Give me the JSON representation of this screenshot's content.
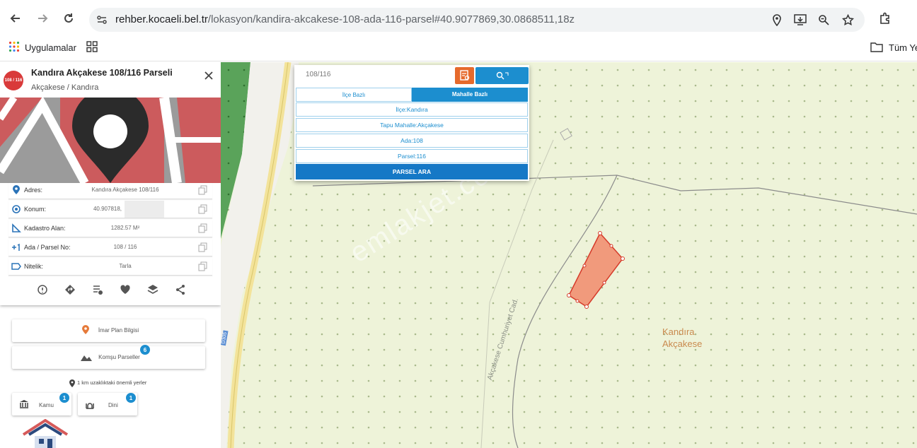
{
  "browser": {
    "url_host": "rehber.kocaeli.bel.tr",
    "url_path": "/lokasyon/kandira-akcakese-108-ada-116-parsel#40.9077869,30.0868511,18z",
    "bookmarks": {
      "apps_label": "Uygulamalar",
      "all_label": "Tüm Ye"
    }
  },
  "panel": {
    "logo_text": "108 / 116",
    "title": "Kandıra Akçakese 108/116 Parseli",
    "subtitle": "Akçakese / Kandıra",
    "rows": [
      {
        "label": "Adres:",
        "value": "Kandıra Akçakese 108/116"
      },
      {
        "label": "Konum:",
        "value": "40.907818,"
      },
      {
        "label": "Kadastro Alan:",
        "value": "1282.57 M²"
      },
      {
        "label": "Ada / Parsel No:",
        "value": "108 / 116"
      },
      {
        "label": "Nitelik:",
        "value": "Tarla"
      }
    ],
    "imar_label": "İmar Plan Bilgisi",
    "komsu_label": "Komşu Parseller",
    "komsu_count": "6",
    "nearby_label": "1 km uzaklıktaki önemli yerler",
    "kamu_label": "Kamu",
    "kamu_count": "1",
    "dini_label": "Dini",
    "dini_count": "1"
  },
  "search": {
    "query": "108/116",
    "tab_ilce": "İlçe Bazlı",
    "tab_mahalle": "Mahalle Bazlı",
    "ilce": "İlçe:Kandıra",
    "mahalle": "Tapu Mahalle:Akçakese",
    "ada": "Ada:108",
    "parsel": "Parsel:116",
    "button": "PARSEL ARA"
  },
  "map": {
    "street_label": "Akçakese Cumhuriyet Cad.",
    "area_line1": "Kandıra",
    "area_line2": "Akçakese",
    "watermark": "emlakjet.com",
    "road_code": "D305",
    "parcel_color": "#f19a7c"
  }
}
